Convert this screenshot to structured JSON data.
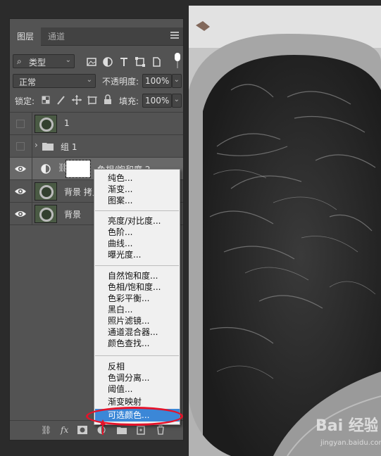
{
  "panel": {
    "tabs": [
      {
        "label": "图层",
        "active": true
      },
      {
        "label": "通道",
        "active": false
      }
    ],
    "filter_kind": "类型",
    "blend_mode": "正常",
    "opacity_label": "不透明度:",
    "opacity_value": "100%",
    "lock_label": "锁定:",
    "fill_label": "填充:",
    "fill_value": "100%"
  },
  "layers": [
    {
      "name": "1",
      "visible": false,
      "kind": "image"
    },
    {
      "name": "组 1",
      "visible": false,
      "kind": "group"
    },
    {
      "name": "色相/饱和度 2",
      "visible": true,
      "kind": "adjustment",
      "selected": true
    },
    {
      "name": "背景 拷贝",
      "visible": true,
      "kind": "image"
    },
    {
      "name": "背景",
      "visible": true,
      "kind": "image"
    }
  ],
  "bottom_bar": {
    "fx": "fx"
  },
  "menu": {
    "items": [
      "纯色...",
      "渐变...",
      "图案...",
      "亮度/对比度...",
      "色阶...",
      "曲线...",
      "曝光度...",
      "自然饱和度...",
      "色相/饱和度...",
      "色彩平衡...",
      "黑白...",
      "照片滤镜...",
      "通道混合器...",
      "颜色查找...",
      "反相",
      "色调分离...",
      "阈值...",
      "渐变映射",
      "可选颜色..."
    ],
    "highlighted": "可选颜色..."
  },
  "watermark": {
    "brand": "Bai 经验",
    "url": "jingyan.baidu.com"
  }
}
